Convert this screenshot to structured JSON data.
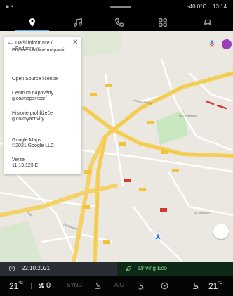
{
  "status": {
    "left_icons": "person-icon",
    "temperature": "-40.0°C",
    "time": "13:14"
  },
  "nav": {
    "items": [
      {
        "name": "navigation",
        "icon": "map-pin-icon",
        "active": true
      },
      {
        "name": "music",
        "icon": "music-icon"
      },
      {
        "name": "phone",
        "icon": "phone-icon"
      },
      {
        "name": "apps",
        "icon": "apps-icon"
      },
      {
        "name": "vehicle",
        "icon": "car-icon"
      }
    ],
    "accent_color": "#4aa3ff"
  },
  "panel": {
    "title": "Další informace / Podpora",
    "items": [
      "Pomoc s offline mapami",
      "Open Source licence",
      "Centrum nápovědy",
      "g.co/mapsincar",
      "Historie prohlížeče",
      "g.co/myactivity",
      "Google Maps",
      "©2021 Google LLC",
      "Verze",
      "11.13.123.E"
    ]
  },
  "map": {
    "labels": [
      "Na Hřebenech",
      "Historie prohlíž",
      "Na Lukách",
      "Aleje",
      "Na Sklepích",
      "Na Slatinách"
    ]
  },
  "info_bar": {
    "date": "22.10.2021",
    "mode": "Driving Eco",
    "mode_color": "#7be08e"
  },
  "climate": {
    "left_temp": "21",
    "left_unit": "°C",
    "fan": "0",
    "sync": "SYNC",
    "ac": "A/C",
    "right_temp": "21",
    "right_unit": "°C"
  }
}
